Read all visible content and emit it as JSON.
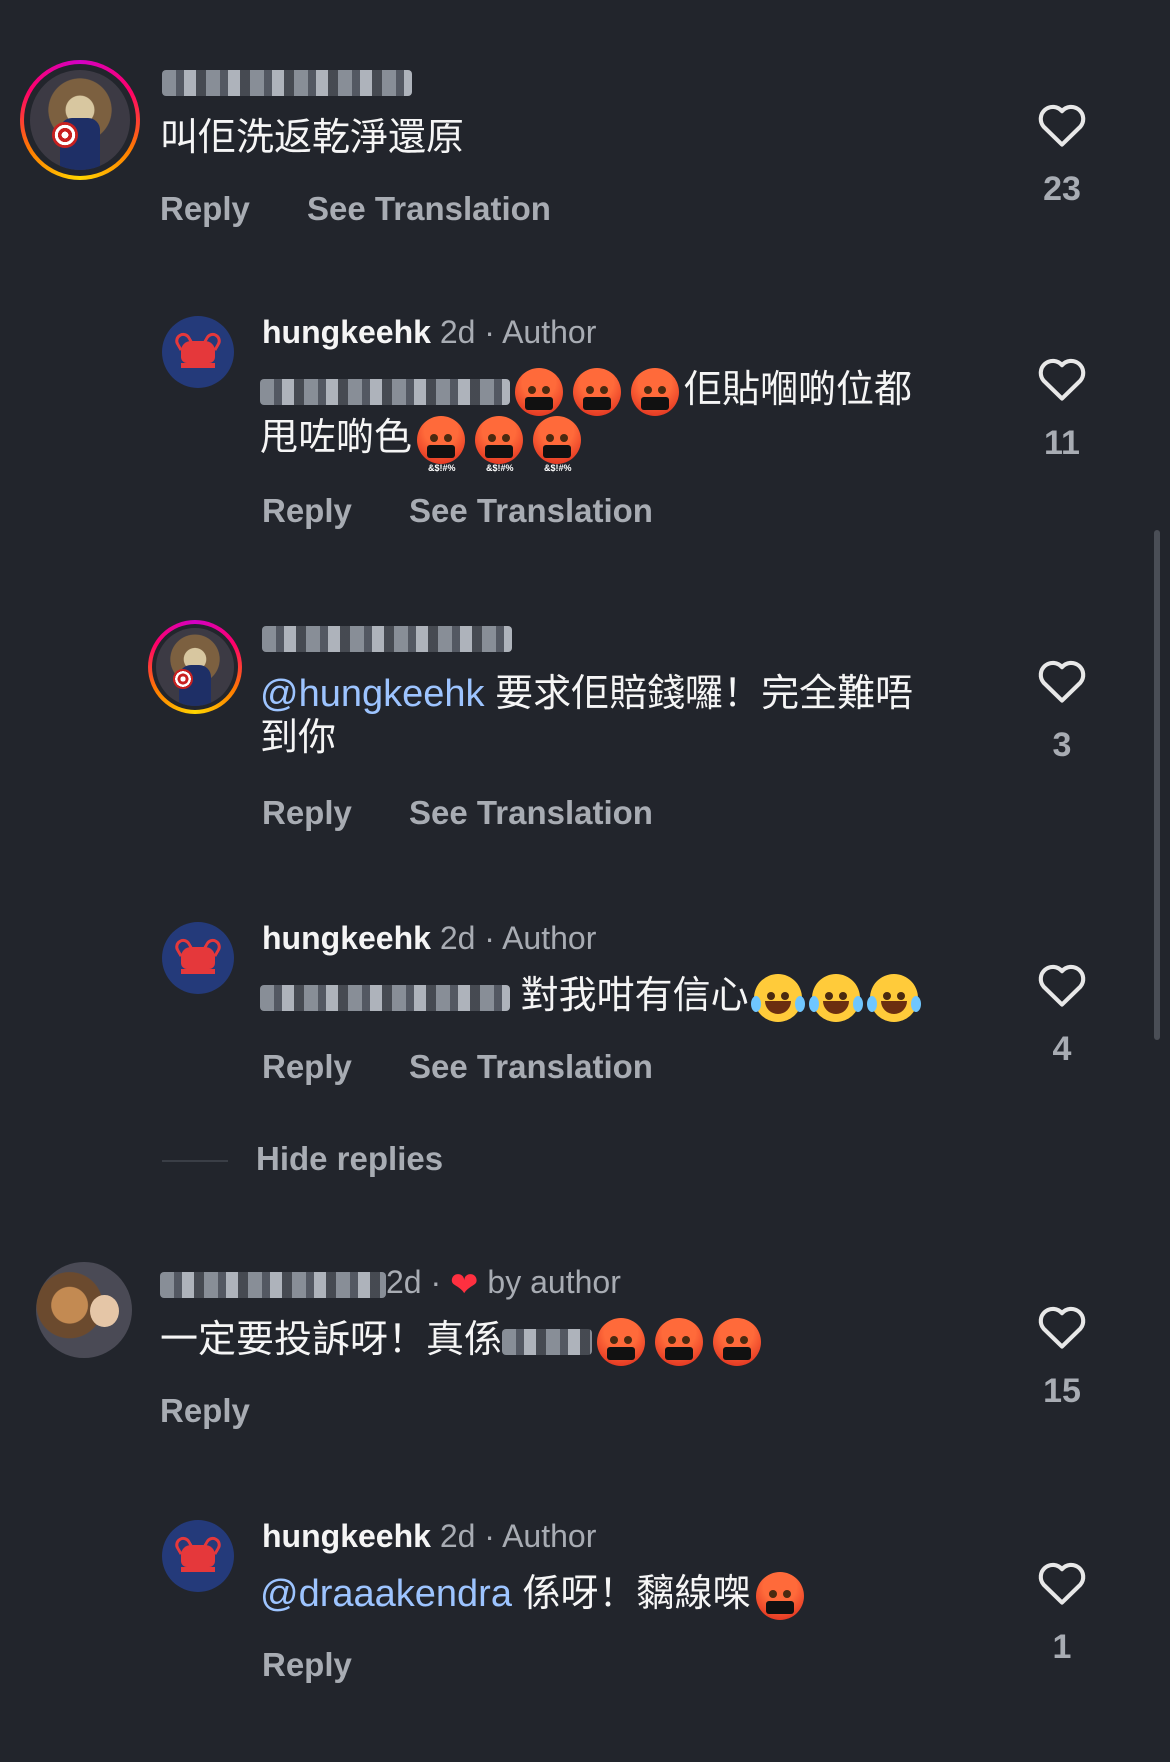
{
  "comments": [
    {
      "username": "",
      "meta": "",
      "text": "叫佢洗返乾淨還原",
      "reply_label": "Reply",
      "translate_label": "See Translation",
      "likes": "23"
    },
    {
      "username": "hungkeehk",
      "meta": "2d · Author",
      "text_line1": "佢貼嗰啲位都",
      "text_line2": "甩咗啲色",
      "emoji_symbol": "&$!#%",
      "reply_label": "Reply",
      "translate_label": "See Translation",
      "likes": "11"
    },
    {
      "username": "",
      "mention": "@hungkeehk",
      "text_line1": " 要求佢賠錢囉！完全難唔",
      "text_line2": "到你",
      "reply_label": "Reply",
      "translate_label": "See Translation",
      "likes": "3"
    },
    {
      "username": "hungkeehk",
      "meta": "2d · Author",
      "text": "對我咁有信心",
      "reply_label": "Reply",
      "translate_label": "See Translation",
      "likes": "4"
    },
    {
      "username": "",
      "meta": "2d ·",
      "liked_by": "by author",
      "text": "一定要投訴呀！真係",
      "reply_label": "Reply",
      "likes": "15"
    },
    {
      "username": "hungkeehk",
      "meta": "2d · Author",
      "mention": "@draaakendra",
      "text": " 係呀！黐線㗎",
      "reply_label": "Reply",
      "likes": "1"
    }
  ],
  "hide_replies_label": "Hide replies",
  "icons": {
    "heart": "heart-outline-icon",
    "liked_by_author": "red-heart-icon"
  },
  "colors": {
    "background": "#22252c",
    "mention": "#9dc4ff",
    "secondary_text": "#a8acb3"
  }
}
